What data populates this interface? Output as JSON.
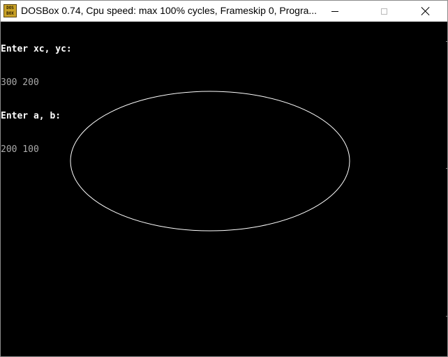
{
  "window": {
    "title": "DOSBox 0.74, Cpu speed: max 100% cycles, Frameskip  0, Progra...",
    "icon": "dosbox-icon",
    "icon_text_top": "DOS",
    "icon_text_bottom": "BOX",
    "controls": [
      "minimize-icon",
      "maximize-icon",
      "close-icon"
    ]
  },
  "console": {
    "lines": [
      {
        "kind": "prompt",
        "text": "Enter xc, yc:"
      },
      {
        "kind": "input",
        "text": "300 200"
      },
      {
        "kind": "prompt",
        "text": "Enter a, b:"
      },
      {
        "kind": "input",
        "text": "200 100"
      }
    ]
  },
  "ellipse": {
    "xc": 300,
    "yc": 200,
    "a": 200,
    "b": 100,
    "color": "#ffffff"
  },
  "colors": {
    "screen_bg": "#000000",
    "prompt_text": "#ffffff",
    "input_text": "#aaaaaa"
  }
}
